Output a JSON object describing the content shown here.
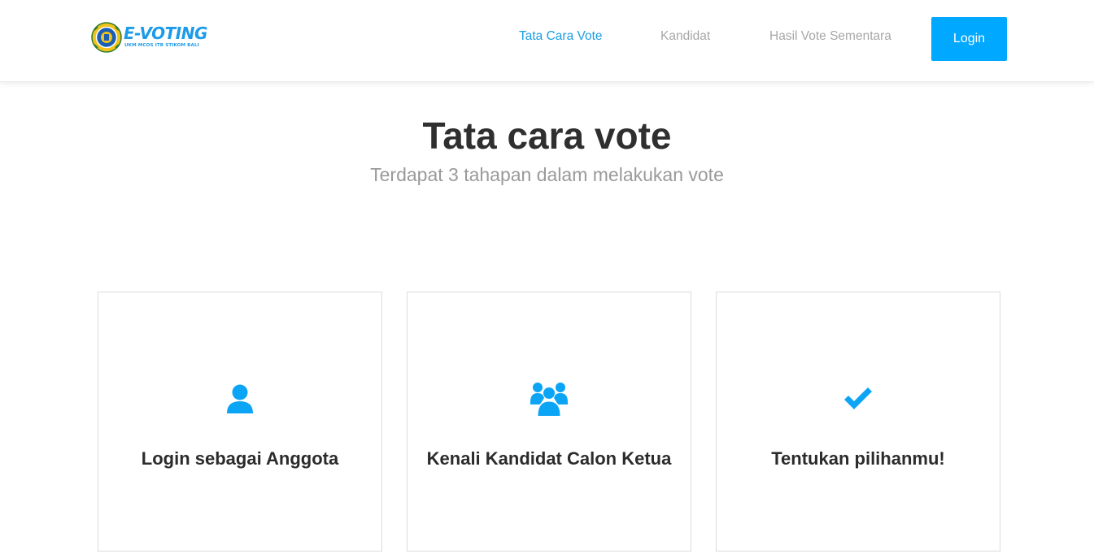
{
  "brand": {
    "title": "E-VOTING",
    "subtitle": "UKM MCOS ITB STIKOM BALI",
    "logo_icon": "org-seal-icon"
  },
  "nav": {
    "items": [
      {
        "label": "Tata Cara Vote",
        "active": true
      },
      {
        "label": "Kandidat",
        "active": false
      },
      {
        "label": "Hasil Vote Sementara",
        "active": false
      }
    ],
    "login_label": "Login"
  },
  "hero": {
    "title": "Tata cara vote",
    "subtitle": "Terdapat 3 tahapan dalam melakukan vote"
  },
  "steps": [
    {
      "icon": "user-icon",
      "title": "Login sebagai Anggota"
    },
    {
      "icon": "users-icon",
      "title": "Kenali Kandidat Calon Ketua"
    },
    {
      "icon": "check-icon",
      "title": "Tentukan pilihanmu!"
    }
  ],
  "colors": {
    "accent": "#00a8ff",
    "active_link": "#1b9ee4",
    "muted_link": "#a7a7a7",
    "heading": "#2f2f2f",
    "subheading": "#9a9a9a"
  }
}
